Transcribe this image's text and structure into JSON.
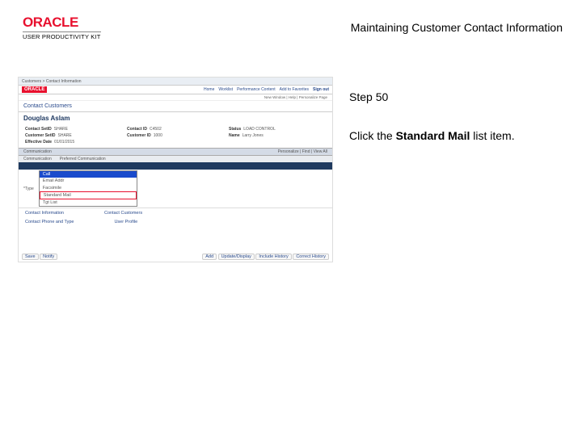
{
  "header": {
    "logo_text": "ORACLE",
    "logo_sub": "USER PRODUCTIVITY KIT",
    "doc_title": "Maintaining Customer Contact Information"
  },
  "instructions": {
    "step_label": "Step 50",
    "line1": "Click the ",
    "bold": "Standard Mail",
    "line2": " list item."
  },
  "screenshot": {
    "oracle_logo": "ORACLE",
    "breadcrumb": "Customers > Contact Information",
    "nav": [
      "Home",
      "Worklist",
      "Performance Content",
      "Add to Favorites",
      "Sign out"
    ],
    "personalize": "New Window | Help | Personalize Page",
    "section": "Contact Customers",
    "person": "Douglas Aslam",
    "fields": {
      "contact_id_lbl": "Contact SetID",
      "contact_id_val": "SHARE",
      "contact_id2_lbl": "Contact ID",
      "contact_id2_val": "C4502",
      "status_lbl": "Status",
      "status_val": "LOAD CONTROL",
      "customer_setid_lbl": "Customer SetID",
      "customer_setid_val": "SHARE",
      "customer_id_lbl": "Customer ID",
      "customer_id_val": "1000",
      "name_lbl": "Name",
      "name_val": "Larry Jones",
      "eff_lbl": "Effective Date",
      "eff_val": "01/01/2015"
    },
    "tab_left": "Communication",
    "tab_right": "Personalize | Find | View All",
    "gray_left": "Communication",
    "gray_right": "Preferred Communication",
    "type_label": "*Type",
    "dropdown": {
      "opt0": "",
      "opt1": "Call",
      "opt2": "Email Addr",
      "opt3": "Facsimile",
      "opt4": "Standard Mail",
      "opt5": "Tgt List"
    },
    "ci_lbl": "Contact Information",
    "cc_lbl": "Contact Customers",
    "cl_lbl": "Contact Phone and Type",
    "uf_lbl": "User Profile",
    "footer_left": {
      "save": "Save",
      "notify": "Notify"
    },
    "footer_right": {
      "add": "Add",
      "update": "Update/Display",
      "history": "Include History",
      "correct": "Correct History"
    }
  }
}
